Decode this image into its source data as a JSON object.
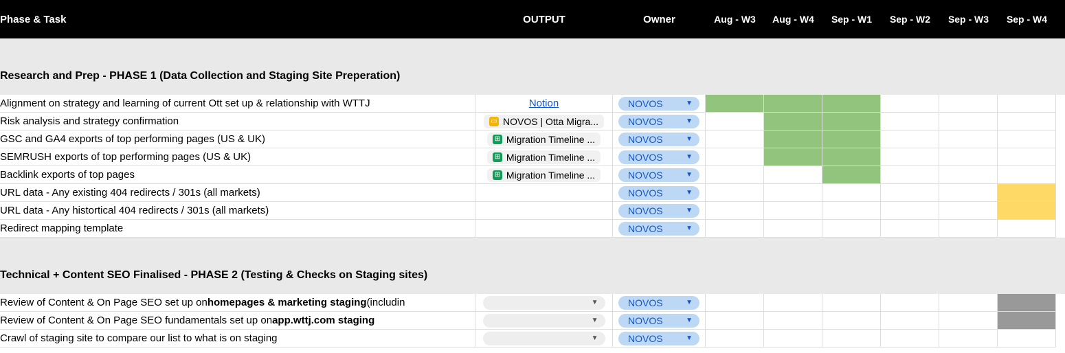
{
  "header": {
    "phase_task": "Phase & Task",
    "output": "OUTPUT",
    "owner": "Owner",
    "weeks": [
      "Aug - W3",
      "Aug - W4",
      "Sep - W1",
      "Sep - W2",
      "Sep - W3",
      "Sep - W4"
    ]
  },
  "sections": [
    {
      "title": "Research and Prep - PHASE 1 (Data Collection and Staging Site Preperation)",
      "rows": [
        {
          "task_html": "Alignment on strategy and learning of current Ott set up & relationship with WTTJ",
          "output": {
            "kind": "link",
            "label": "Notion "
          },
          "owner": "NOVOS",
          "fills": [
            "green",
            "green",
            "green",
            "",
            "",
            ""
          ]
        },
        {
          "task_html": "Risk analysis and strategy confirmation",
          "output": {
            "kind": "slide",
            "label": "NOVOS | Otta  Migra..."
          },
          "owner": "NOVOS",
          "fills": [
            "",
            "green",
            "green",
            "",
            "",
            ""
          ]
        },
        {
          "task_html": "GSC and GA4 exports of top performing pages (US & UK)",
          "output": {
            "kind": "sheet",
            "label": "Migration Timeline  ..."
          },
          "owner": "NOVOS",
          "fills": [
            "",
            "green",
            "green",
            "",
            "",
            ""
          ]
        },
        {
          "task_html": "SEMRUSH exports of top performing pages  (US & UK)",
          "output": {
            "kind": "sheet",
            "label": "Migration Timeline  ..."
          },
          "owner": "NOVOS",
          "fills": [
            "",
            "green",
            "green",
            "",
            "",
            ""
          ]
        },
        {
          "task_html": "Backlink exports of top pages",
          "output": {
            "kind": "sheet",
            "label": "Migration Timeline  ..."
          },
          "owner": "NOVOS",
          "fills": [
            "",
            "",
            "green",
            "",
            "",
            ""
          ]
        },
        {
          "task_html": "URL data - Any existing 404 redirects / 301s (all markets)",
          "output": {
            "kind": "none"
          },
          "owner": "NOVOS",
          "fills": [
            "",
            "",
            "",
            "",
            "",
            "yellow"
          ]
        },
        {
          "task_html": "URL data - Any histortical 404 redirects / 301s (all markets)",
          "output": {
            "kind": "none"
          },
          "owner": "NOVOS",
          "fills": [
            "",
            "",
            "",
            "",
            "",
            "yellow"
          ]
        },
        {
          "task_html": "Redirect mapping template",
          "output": {
            "kind": "none"
          },
          "owner": "NOVOS",
          "fills": [
            "",
            "",
            "",
            "",
            "",
            ""
          ]
        }
      ]
    },
    {
      "title": "Technical + Content SEO Finalised - PHASE 2 (Testing & Checks on Staging sites)",
      "rows": [
        {
          "task_html": "Review of Content & On Page SEO set up on <b>homepages & marketing staging</b>  (includin",
          "output": {
            "kind": "dropdown"
          },
          "owner": "NOVOS",
          "fills": [
            "",
            "",
            "",
            "",
            "",
            "grey"
          ]
        },
        {
          "task_html": "Review of Content & On Page SEO fundamentals set up on <b>app.wttj.com staging</b>",
          "output": {
            "kind": "dropdown"
          },
          "owner": "NOVOS",
          "fills": [
            "",
            "",
            "",
            "",
            "",
            "grey"
          ]
        },
        {
          "task_html": "Crawl of staging site to compare our list to what is on staging",
          "output": {
            "kind": "dropdown"
          },
          "owner": "NOVOS",
          "fills": [
            "",
            "",
            "",
            "",
            "",
            ""
          ]
        }
      ]
    }
  ]
}
